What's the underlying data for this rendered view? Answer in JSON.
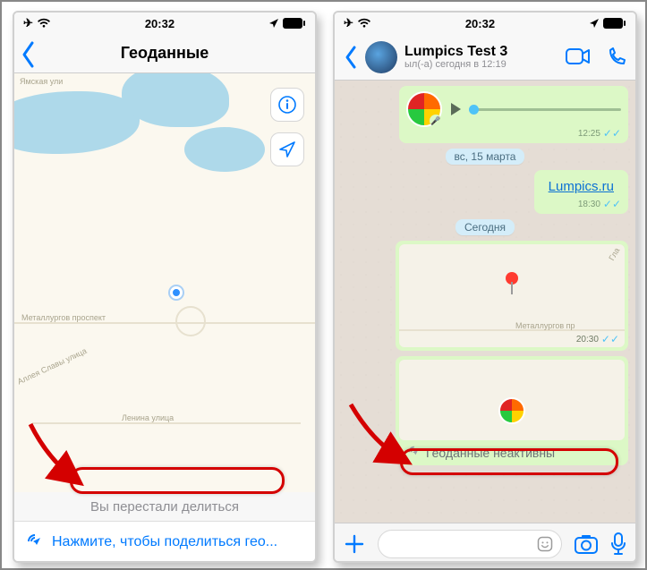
{
  "status": {
    "time": "20:32"
  },
  "left": {
    "title": "Геоданные",
    "stopped": "Вы перестали делиться",
    "share": "Нажмите, чтобы поделиться гео...",
    "roads": {
      "metallurgov": "Металлургов проспект",
      "slavy": "Аллея Славы улица",
      "lenina": "Ленина улица",
      "yamskaya": "Ямская ули"
    }
  },
  "right": {
    "contact": "Lumpics Test 3",
    "presence": "ыл(-а) сегодня в 12:19",
    "voice_time": "12:25",
    "date1": "вс, 15 марта",
    "link": "Lumpics.ru",
    "link_time": "18:30",
    "date2": "Сегодня",
    "loc_time": "20:30",
    "loc_road": "Металлургов пр",
    "live_label": "Геоданные неактивны"
  }
}
